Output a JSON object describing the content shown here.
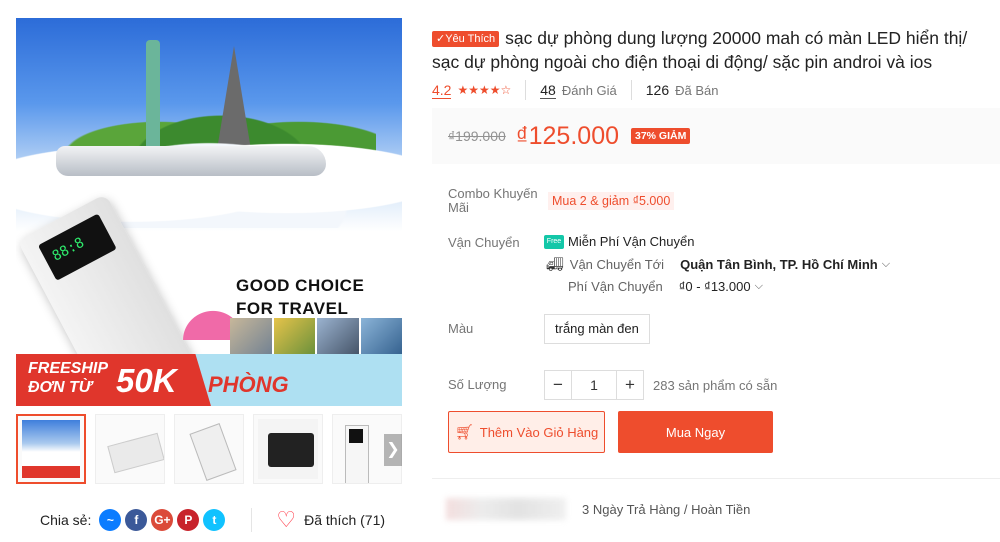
{
  "product": {
    "favorite_badge": "✓Yêu Thích",
    "title": "sạc dự phòng dung lượng 20000 mah có màn LED hiển thị/ sạc dự phòng ngoài cho điện thoại di động/ sặc pin androi và ios",
    "rating": "4.2",
    "stars": "★★★★☆",
    "review_count": "48",
    "review_label": "Đánh Giá",
    "sold_count": "126",
    "sold_label": "Đã Bán"
  },
  "price": {
    "old": "₫199.000",
    "new": "₫125.000",
    "discount": "37% GIẢM"
  },
  "combo": {
    "label": "Combo Khuyến Mãi",
    "tag": "Mua 2 & giảm ₫5.000"
  },
  "shipping": {
    "label": "Vận Chuyển",
    "free_icon": "Free",
    "free_text": "Miễn Phí Vận Chuyển",
    "to_label": "Vận Chuyển Tới",
    "to_value": "Quận Tân Bình, TP. Hồ Chí Minh",
    "fee_label": "Phí Vận Chuyển",
    "fee_value": "₫0 - ₫13.000"
  },
  "variant": {
    "label": "Màu",
    "option": "trắng màn đen"
  },
  "quantity": {
    "label": "Số Lượng",
    "minus": "−",
    "value": "1",
    "plus": "+",
    "stock": "283 sản phẩm có sẵn"
  },
  "actions": {
    "add_to_cart": "Thêm Vào Giỏ Hàng",
    "buy_now": "Mua Ngay"
  },
  "guarantee": {
    "return_text": "3 Ngày Trả Hàng / Hoàn Tiền"
  },
  "gallery": {
    "main_text_1": "GOOD CHOICE",
    "main_text_2": "FOR TRAVEL",
    "freeship_1": "FREESHIP",
    "freeship_2": "ĐƠN TỪ",
    "freeship_3": "50K",
    "phong": "PHÒNG",
    "screen_digits": "88:8",
    "next_arrow": "❯"
  },
  "share": {
    "label": "Chia sẻ:",
    "icons": [
      "messenger-icon",
      "facebook-icon",
      "google-plus-icon",
      "pinterest-icon",
      "twitter-icon"
    ],
    "liked_text": "Đã thích (71)"
  },
  "colors": {
    "accent": "#ee4d2d",
    "free_ship": "#13c7a8"
  }
}
